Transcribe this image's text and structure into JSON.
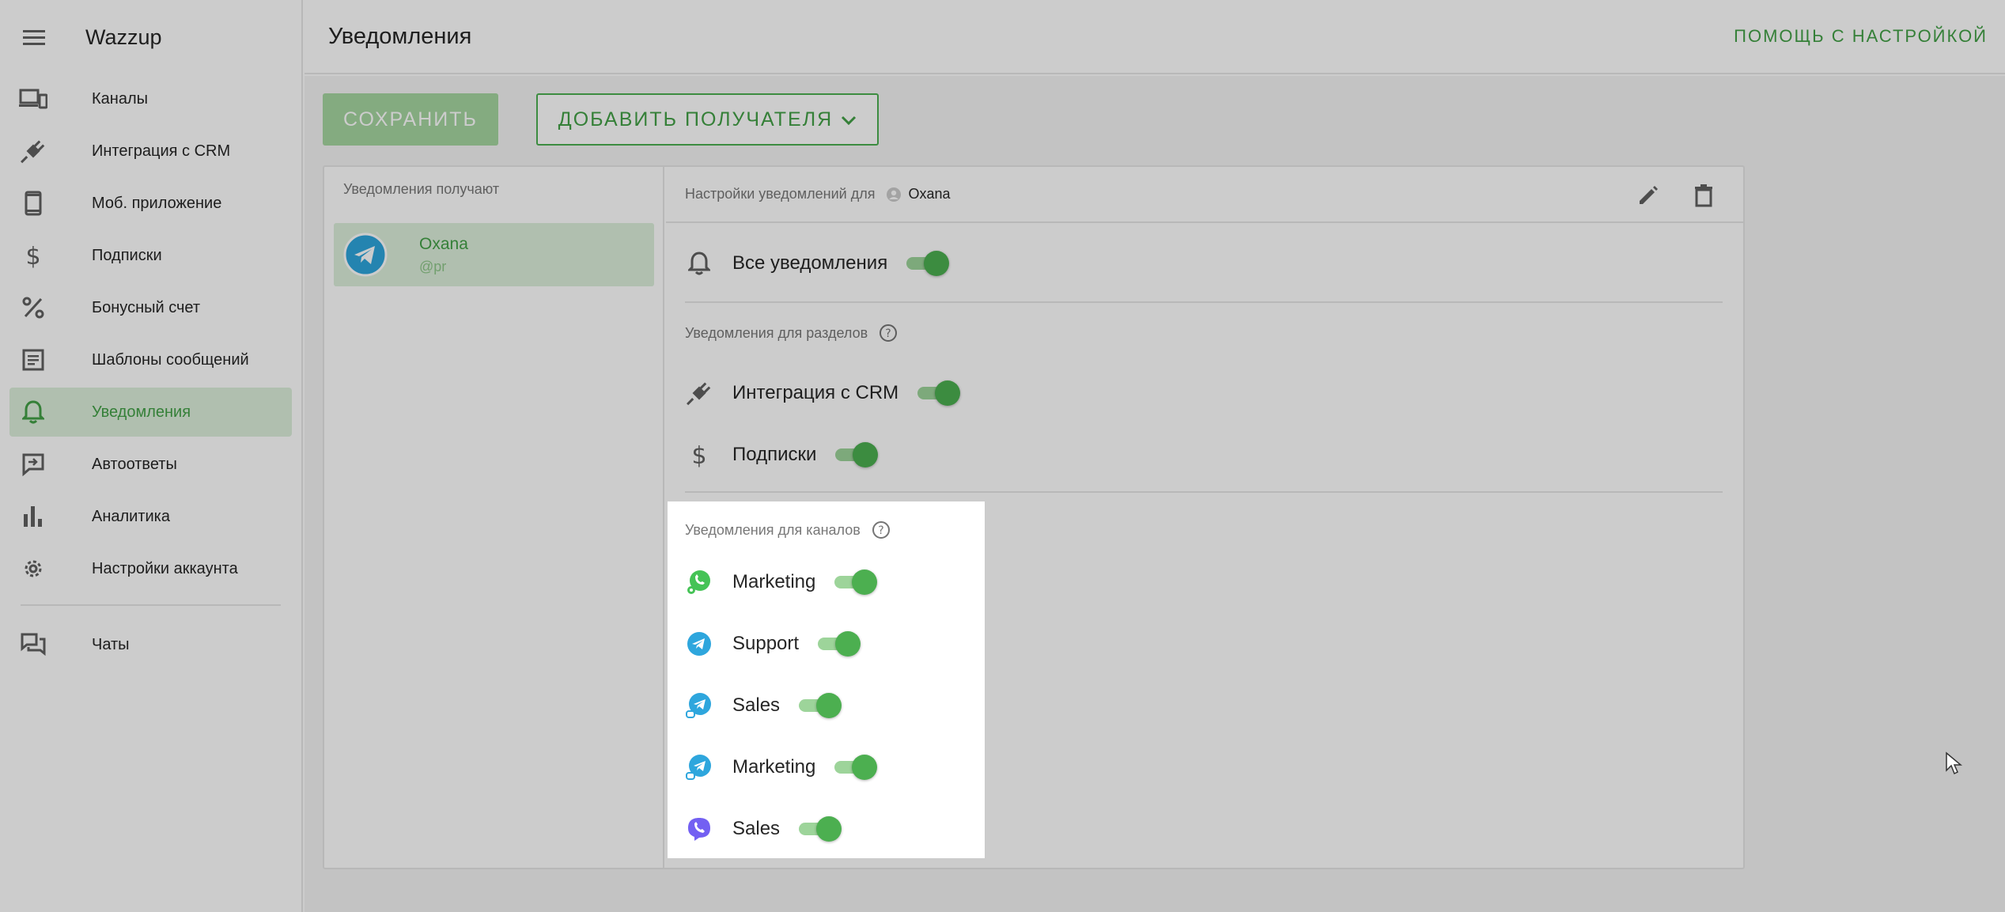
{
  "sidebar": {
    "brand": "Wazzup",
    "items": [
      {
        "label": "Каналы",
        "icon": "devices-icon"
      },
      {
        "label": "Интеграция с CRM",
        "icon": "plug-icon"
      },
      {
        "label": "Моб. приложение",
        "icon": "phone-icon"
      },
      {
        "label": "Подписки",
        "icon": "dollar-icon"
      },
      {
        "label": "Бонусный счет",
        "icon": "percent-icon"
      },
      {
        "label": "Шаблоны сообщений",
        "icon": "template-icon"
      },
      {
        "label": "Уведомления",
        "icon": "bell-icon",
        "active": true
      },
      {
        "label": "Автоответы",
        "icon": "autoreply-icon"
      },
      {
        "label": "Аналитика",
        "icon": "chart-icon"
      },
      {
        "label": "Настройки аккаунта",
        "icon": "gear-icon"
      },
      {
        "label": "Чаты",
        "icon": "chats-icon"
      }
    ]
  },
  "header": {
    "title": "Уведомления",
    "help": "ПОМОЩЬ С НАСТРОЙКОЙ"
  },
  "toolbar": {
    "save_label": "СОХРАНИТЬ",
    "add_label": "ДОБАВИТЬ ПОЛУЧАТЕЛЯ"
  },
  "recipients": {
    "title": "Уведомления получают",
    "items": [
      {
        "name": "Oxana",
        "handle": "@pr"
      }
    ]
  },
  "settings": {
    "header_prefix": "Настройки уведомлений для",
    "user": "Oxana",
    "all": {
      "label": "Все уведомления",
      "on": true
    },
    "sections_title": "Уведомления для разделов",
    "sections": [
      {
        "label": "Интеграция с CRM",
        "on": true
      },
      {
        "label": "Подписки",
        "on": true
      }
    ],
    "channels_title": "Уведомления для каналов",
    "channels": [
      {
        "label": "Marketing",
        "type": "whatsapp",
        "on": true
      },
      {
        "label": "Support",
        "type": "telegram",
        "on": true
      },
      {
        "label": "Sales",
        "type": "telegram-personal",
        "on": true
      },
      {
        "label": "Marketing",
        "type": "telegram-personal",
        "on": true
      },
      {
        "label": "Sales",
        "type": "viber",
        "on": true
      }
    ]
  },
  "colors": {
    "accent": "#4caf50",
    "accent_text": "#43a047",
    "active_bg": "#dcefdb",
    "telegram": "#2ea6dd",
    "whatsapp": "#45c356",
    "viber": "#7360f2"
  }
}
